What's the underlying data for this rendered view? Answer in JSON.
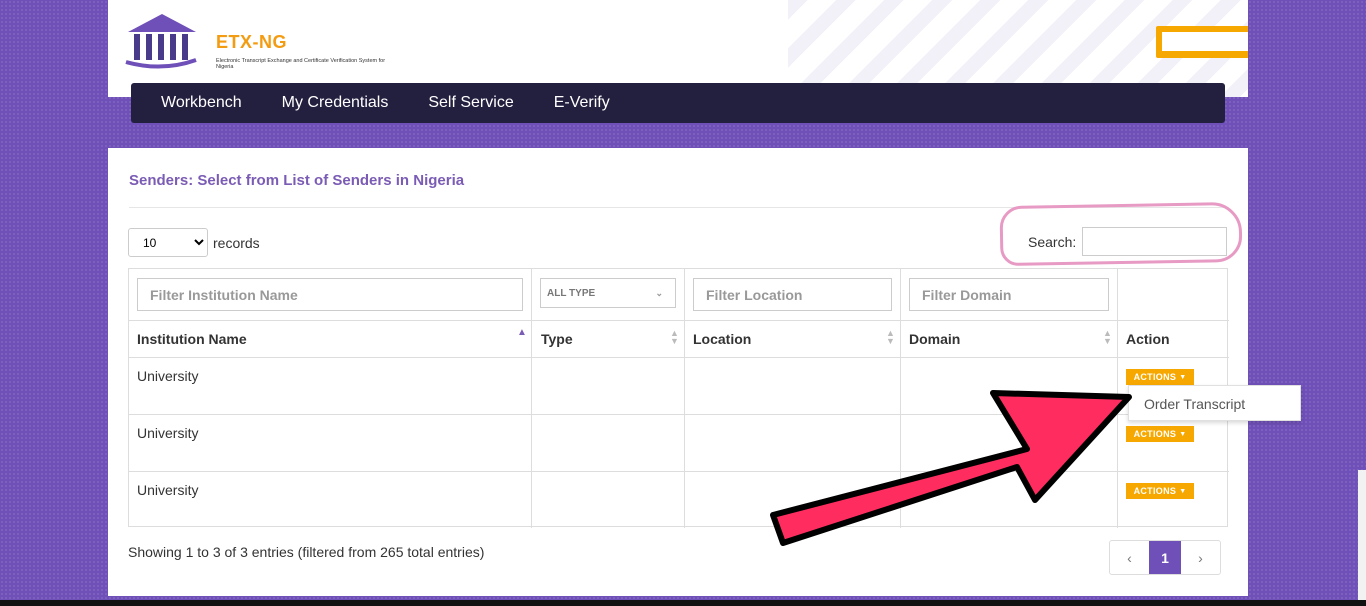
{
  "logo": {
    "name": "ETX-NG",
    "subtitle": "Electronic Transcript Exchange and Certificate Verification System for Nigeria"
  },
  "nav": {
    "items": [
      "Workbench",
      "My Credentials",
      "Self Service",
      "E-Verify"
    ]
  },
  "page": {
    "title": "Senders: Select from List of Senders in Nigeria",
    "records_value": "10",
    "records_label": "records",
    "search_label": "Search:",
    "search_value": ""
  },
  "filters": {
    "institution_placeholder": "Filter Institution Name",
    "type_value": "ALL TYPE",
    "location_placeholder": "Filter Location",
    "domain_placeholder": "Filter Domain"
  },
  "table": {
    "headers": [
      "Institution Name",
      "Type",
      "Location",
      "Domain",
      "Action"
    ],
    "rows": [
      {
        "institution": "University",
        "type": "",
        "location": "",
        "domain": "",
        "action": "ACTIONS"
      },
      {
        "institution": "University",
        "type": "",
        "location": "",
        "domain": "",
        "action": "ACTIONS"
      },
      {
        "institution": "University",
        "type": "",
        "location": "",
        "domain": "",
        "action": "ACTIONS"
      }
    ]
  },
  "dropdown": {
    "items": [
      "Order Transcript"
    ]
  },
  "footer": {
    "showing": "Showing 1 to 3 of 3 entries (filtered from 265 total entries)",
    "pager_prev": "‹",
    "pager_current": "1",
    "pager_next": "›"
  },
  "colors": {
    "accent": "#6f4fb8",
    "nav_bg": "#231f3f",
    "action": "#f7a800",
    "annotation": "#ff2d5f"
  }
}
